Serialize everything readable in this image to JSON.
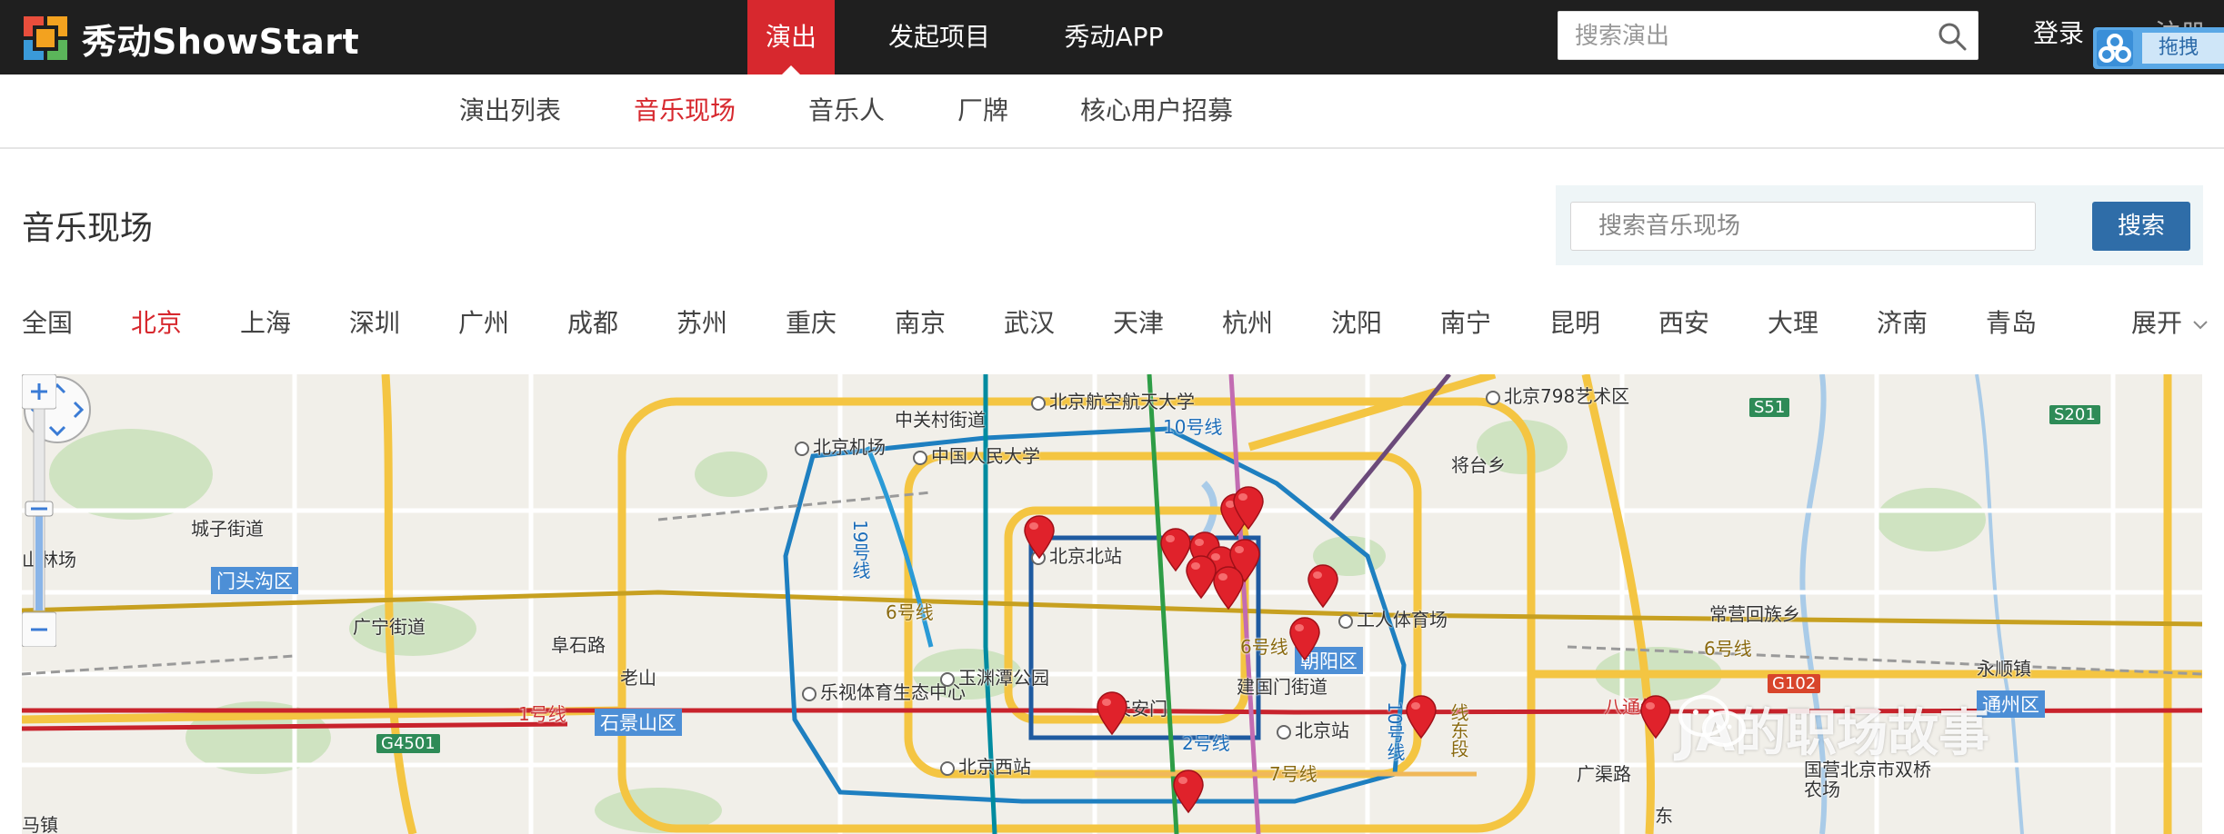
{
  "header": {
    "logo_text": "秀动ShowStart",
    "nav": [
      "演出",
      "发起项目",
      "秀动APP"
    ],
    "active_nav": "演出",
    "search_placeholder": "搜索演出",
    "login": "登录",
    "register": "注册",
    "float_label": "拖拽"
  },
  "subnav": {
    "items": [
      "演出列表",
      "音乐现场",
      "音乐人",
      "厂牌",
      "核心用户招募"
    ],
    "active": "音乐现场"
  },
  "page": {
    "title": "音乐现场",
    "search_placeholder": "搜索音乐现场",
    "search_button": "搜索"
  },
  "cities": [
    "全国",
    "北京",
    "上海",
    "深圳",
    "广州",
    "成都",
    "苏州",
    "重庆",
    "南京",
    "武汉",
    "天津",
    "杭州",
    "沈阳",
    "南宁",
    "昆明",
    "西安",
    "大理",
    "济南",
    "青岛"
  ],
  "active_city": "北京",
  "expand_label": "展开",
  "map": {
    "labels": {
      "zhongguancun": "中关村街道",
      "bhang": "北京航空航天大学",
      "renda": "中国人民大学",
      "jichang": "北京机场",
      "line10": "10号线",
      "art798": "北京798艺术区",
      "jiangtai": "将台乡",
      "s51": "S51",
      "s201": "S201",
      "chengzi": "城子街道",
      "mentougou": "门头沟区",
      "line19": "19号线",
      "beijingbei": "北京北站",
      "gongti": "工人体育场",
      "changying": "常营回族乡",
      "guangning": "广宁街道",
      "line6a": "6号线",
      "line6b": "6号线",
      "line6c": "6号线",
      "chaoyang": "朝阳区",
      "yongshun": "永顺镇",
      "fushilu": "阜石路",
      "laoshan": "老山",
      "lszx": "乐视体育生态中心",
      "yuyuantan": "玉渊潭公园",
      "jianguomen": "建国门街道",
      "g102": "G102",
      "tongzhou": "通州区",
      "line1": "1号线",
      "shijingshan": "石景山区",
      "tiananmen": "天安门",
      "bjzhan": "北京站",
      "line2": "2号线",
      "line7": "7号线",
      "batong": "八通线",
      "g4501": "G4501",
      "bjxizhan": "北京西站",
      "guangqulu": "广渠路",
      "shuangqiao": "国营北京市双桥农场",
      "wanshan": "山林场",
      "sanfu": "马镇",
      "line10b": "10号线",
      "dong": "东",
      "sixhuan": "线东段"
    },
    "watermark": "JA的职场故事"
  }
}
